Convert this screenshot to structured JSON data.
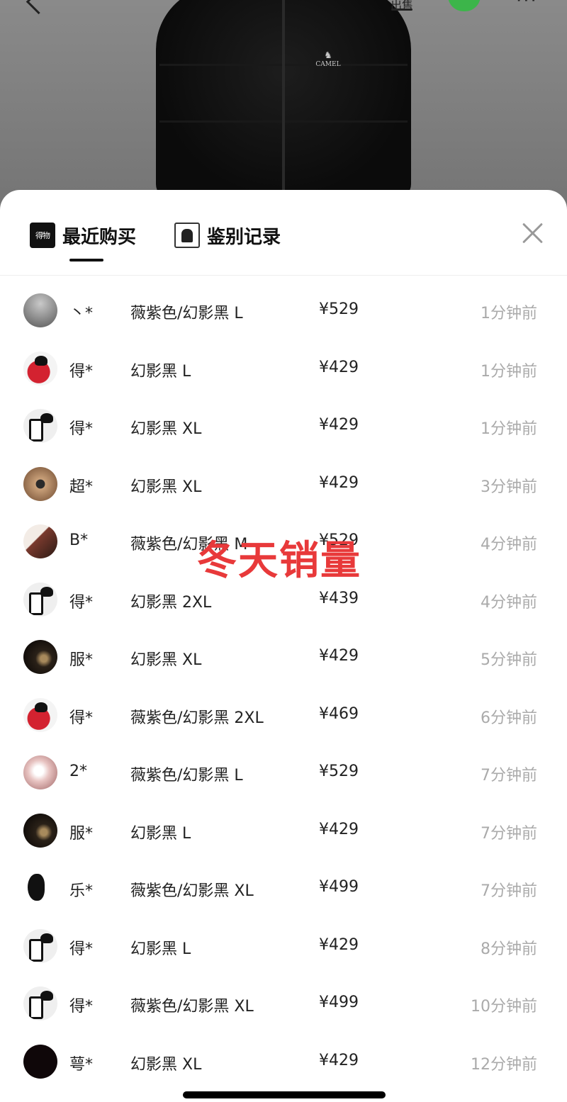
{
  "header": {
    "brand_logo_text": "CAMEL",
    "share_label": "出售"
  },
  "tabs": [
    {
      "label": "最近购买",
      "icon": "dewu-logo-icon",
      "icon_text": "得物",
      "active": true
    },
    {
      "label": "鉴别记录",
      "icon": "jacket-icon",
      "active": false
    }
  ],
  "purchases": [
    {
      "user": "丶*",
      "spec": "薇紫色/幻影黑 L",
      "price": "¥529",
      "time": "1分钟前",
      "avatar": "gray"
    },
    {
      "user": "得*",
      "spec": "幻影黑 L",
      "price": "¥429",
      "time": "1分钟前",
      "avatar": "red"
    },
    {
      "user": "得*",
      "spec": "幻影黑 XL",
      "price": "¥429",
      "time": "1分钟前",
      "avatar": "bw"
    },
    {
      "user": "超*",
      "spec": "幻影黑 XL",
      "price": "¥429",
      "time": "3分钟前",
      "avatar": "dog"
    },
    {
      "user": "B*",
      "spec": "薇紫色/幻影黑 M",
      "price": "¥529",
      "time": "4分钟前",
      "avatar": "piano"
    },
    {
      "user": "得*",
      "spec": "幻影黑 2XL",
      "price": "¥439",
      "time": "4分钟前",
      "avatar": "bw"
    },
    {
      "user": "服*",
      "spec": "幻影黑 XL",
      "price": "¥429",
      "time": "5分钟前",
      "avatar": "dark"
    },
    {
      "user": "得*",
      "spec": "薇紫色/幻影黑 2XL",
      "price": "¥469",
      "time": "6分钟前",
      "avatar": "red"
    },
    {
      "user": "2*",
      "spec": "薇紫色/幻影黑 L",
      "price": "¥529",
      "time": "7分钟前",
      "avatar": "pink"
    },
    {
      "user": "服*",
      "spec": "幻影黑 L",
      "price": "¥429",
      "time": "7分钟前",
      "avatar": "dark"
    },
    {
      "user": "乐*",
      "spec": "薇紫色/幻影黑 XL",
      "price": "¥499",
      "time": "7分钟前",
      "avatar": "sil"
    },
    {
      "user": "得*",
      "spec": "幻影黑 L",
      "price": "¥429",
      "time": "8分钟前",
      "avatar": "bw"
    },
    {
      "user": "得*",
      "spec": "薇紫色/幻影黑 XL",
      "price": "¥499",
      "time": "10分钟前",
      "avatar": "bw"
    },
    {
      "user": "萼*",
      "spec": "幻影黑 XL",
      "price": "¥429",
      "time": "12分钟前",
      "avatar": "black"
    }
  ],
  "watermark": "冬天销量",
  "colors": {
    "watermark": "#e8393a",
    "time_text": "#aaaaaa",
    "wechat": "#3cb54a"
  }
}
